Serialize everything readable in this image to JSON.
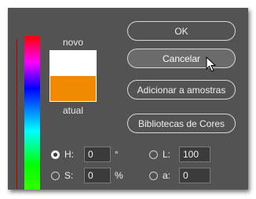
{
  "swatches": {
    "new_label": "novo",
    "current_label": "atual",
    "new_color": "#ffffff",
    "current_color": "#f08a00"
  },
  "buttons": {
    "ok": "OK",
    "cancel": "Cancelar",
    "add_to_swatches": "Adicionar a amostras",
    "color_libraries": "Bibliotecas de Cores"
  },
  "fields": {
    "h": {
      "label": "H:",
      "value": "0",
      "unit": "°",
      "selected": true
    },
    "s": {
      "label": "S:",
      "value": "0",
      "unit": "%",
      "selected": false
    },
    "l": {
      "label": "L:",
      "value": "100",
      "selected": false
    },
    "a": {
      "label": "a:",
      "value": "0",
      "selected": false
    }
  }
}
